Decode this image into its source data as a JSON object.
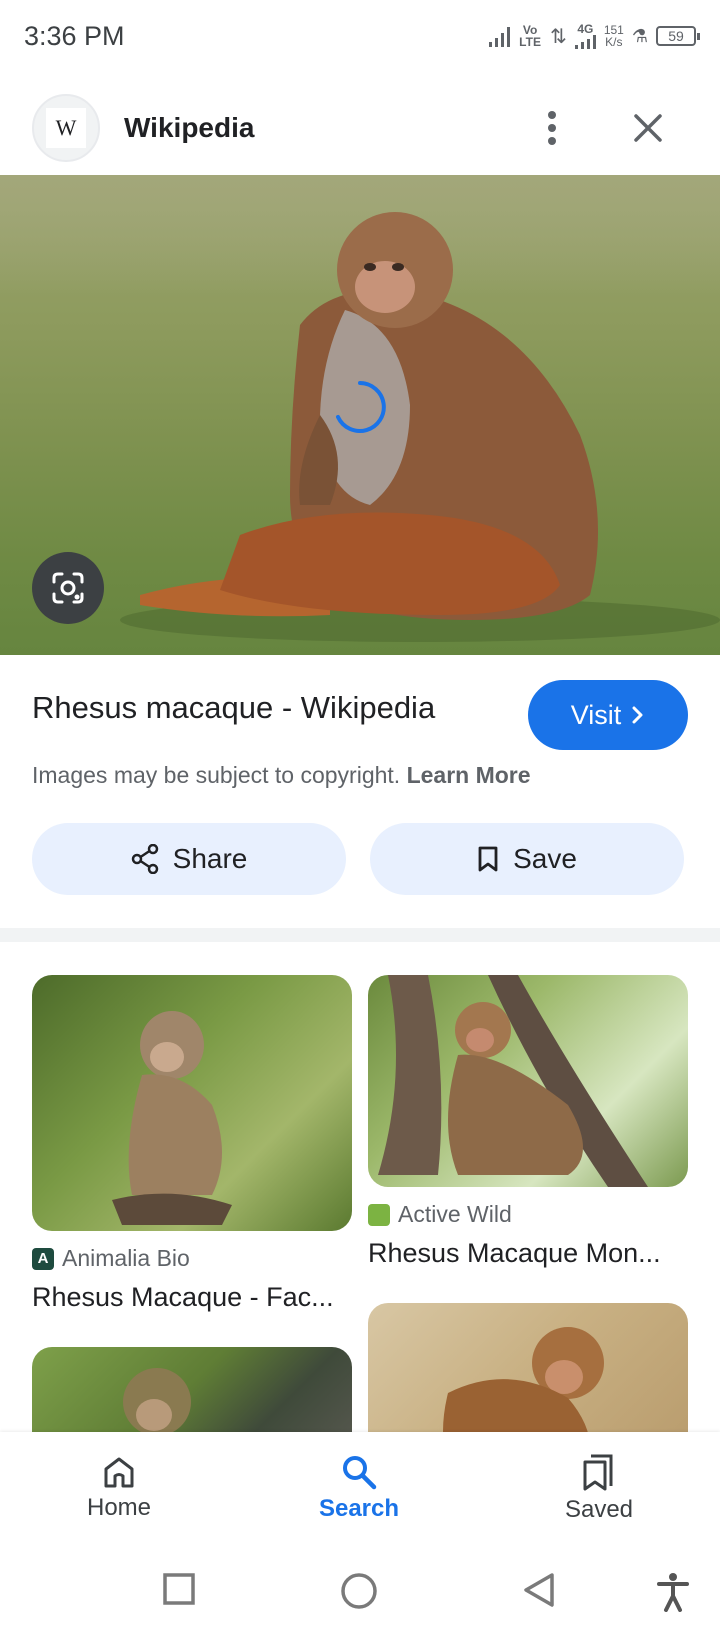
{
  "status_bar": {
    "time": "3:36 PM",
    "network_label": "Vo LTE",
    "network_gen": "4G",
    "speed_value": "151",
    "speed_unit": "K/s",
    "battery": "59"
  },
  "header": {
    "logo_letter": "W",
    "site_name": "Wikipedia",
    "more_icon": "more-vert-icon",
    "close_icon": "close-icon"
  },
  "hero": {
    "subject": "Rhesus macaque sitting on grass",
    "lens_icon": "lens-icon",
    "loading_icon": "loading-spinner-icon"
  },
  "result": {
    "title": "Rhesus macaque - Wikipedia",
    "visit_label": "Visit",
    "copyright_text": "Images may be subject to copyright.",
    "learn_more": "Learn More",
    "share_label": "Share",
    "save_label": "Save"
  },
  "related": [
    {
      "source": "Animalia Bio",
      "source_icon_letter": "A",
      "title": "Rhesus Macaque - Fac..."
    },
    {
      "source": "Active Wild",
      "source_icon_letter": "",
      "title": "Rhesus Macaque Mon..."
    }
  ],
  "bottom_nav": {
    "home": "Home",
    "search": "Search",
    "saved": "Saved"
  },
  "colors": {
    "accent": "#1a73e8",
    "button_bg": "#e8f0fe",
    "text_secondary": "#5f6368"
  }
}
